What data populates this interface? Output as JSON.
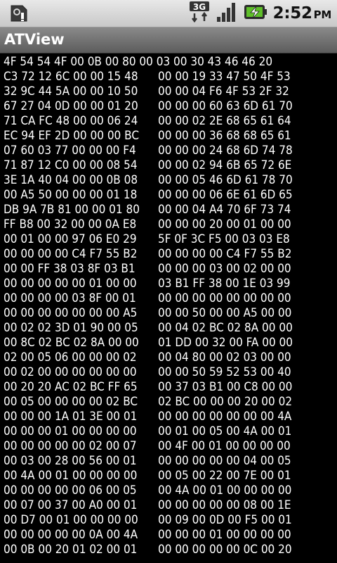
{
  "status_bar": {
    "time": "2:52",
    "ampm": "PM",
    "network": "3G",
    "icons": [
      "sd-card-icon",
      "3g-data-icon",
      "signal-strength-icon",
      "battery-charging-icon"
    ]
  },
  "app": {
    "title": "ATView"
  },
  "hex_rows": [
    {
      "left": "4F 54 54 4F 00 0B 00 80 00 03 00 30 43 46 46 20",
      "right": ""
    },
    {
      "left": "C3 72 12 6C 00 00 15 48",
      "right": "00 00 19 33 47 50 4F 53"
    },
    {
      "left": "32 9C 44 5A 00 00 10 50",
      "right": "00 00 04 F6 4F 53 2F 32"
    },
    {
      "left": "67 27 04 0D 00 00 01 20",
      "right": "00 00 00 60 63 6D 61 70"
    },
    {
      "left": "71 CA FC 48 00 00 06 24",
      "right": "00 00 02 2E 68 65 61 64"
    },
    {
      "left": "EC 94 EF 2D 00 00 00 BC",
      "right": "00 00 00 36 68 68 65 61"
    },
    {
      "left": "07 60 03 77 00 00 00 F4",
      "right": "00 00 00 24 68 6D 74 78"
    },
    {
      "left": "71 87 12 C0 00 00 08 54",
      "right": "00 00 02 94 6B 65 72 6E"
    },
    {
      "left": "3E 1A 40 04 00 00 0B 08",
      "right": "00 00 05 46 6D 61 78 70"
    },
    {
      "left": "00 A5 50 00 00 00 01 18",
      "right": "00 00 00 06 6E 61 6D 65"
    },
    {
      "left": "DB 9A 7B 81 00 00 01 80",
      "right": "00 00 04 A4 70 6F 73 74"
    },
    {
      "left": "FF B8 00 32 00 00 0A E8",
      "right": "00 00 00 20 00 01 00 00"
    },
    {
      "left": "00 01 00 00 97 06 E0 29",
      "right": "5F 0F 3C F5 00 03 03 E8"
    },
    {
      "left": "00 00 00 00 C4 F7 55 B2",
      "right": "00 00 00 00 C4 F7 55 B2"
    },
    {
      "left": "00 00 FF 38 03 8F 03 B1",
      "right": "00 00 00 03 00 02 00 00"
    },
    {
      "left": "00 00 00 00 00 01 00 00",
      "right": "03 B1 FF 38 00 1E 03 99"
    },
    {
      "left": "00 00 00 00 03 8F 00 01",
      "right": "00 00 00 00 00 00 00 00"
    },
    {
      "left": "00 00 00 00 00 00 00 A5",
      "right": "00 00 50 00 00 A5 00 00"
    },
    {
      "left": "00 02 02 3D 01 90 00 05",
      "right": "00 04 02 BC 02 8A 00 00"
    },
    {
      "left": "00 8C 02 BC 02 8A 00 00",
      "right": "01 DD 00 32 00 FA 00 00"
    },
    {
      "left": "02 00 05 06 00 00 00 02",
      "right": "00 04 80 00 02 03 00 00"
    },
    {
      "left": "00 02 00 00 00 00 00 00",
      "right": "00 00 50 59 52 53 00 40"
    },
    {
      "left": "00 20 20 AC 02 BC FF 65",
      "right": "00 37 03 B1 00 C8 00 00"
    },
    {
      "left": "00 05 00 00 00 00 02 BC",
      "right": "02 BC 00 00 00 20 00 02"
    },
    {
      "left": "00 00 00 1A 01 3E 00 01",
      "right": "00 00 00 00 00 00 00 4A"
    },
    {
      "left": "00 00 00 01 00 00 00 00",
      "right": "00 01 00 05 00 4A 00 01"
    },
    {
      "left": "00 00 00 00 00 02 00 07",
      "right": "00 4F 00 01 00 00 00 00"
    },
    {
      "left": "00 03 00 28 00 56 00 01",
      "right": "00 00 00 00 00 04 00 05"
    },
    {
      "left": "00 4A 00 01 00 00 00 00",
      "right": "00 05 00 22 00 7E 00 01"
    },
    {
      "left": "00 00 00 00 00 06 00 05",
      "right": "00 4A 00 01 00 00 00 00"
    },
    {
      "left": "00 07 00 37 00 A0 00 01",
      "right": "00 00 00 00 00 08 00 1E"
    },
    {
      "left": "00 D7 00 01 00 00 00 00",
      "right": "00 09 00 0D 00 F5 00 01"
    },
    {
      "left": "00 00 00 00 00 0A 00 4A",
      "right": "00 00 00 01 00 00 00 00"
    },
    {
      "left": "00 0B 00 20 01 02 00 01",
      "right": "00 00 00 00 00 0C 00 20"
    }
  ]
}
